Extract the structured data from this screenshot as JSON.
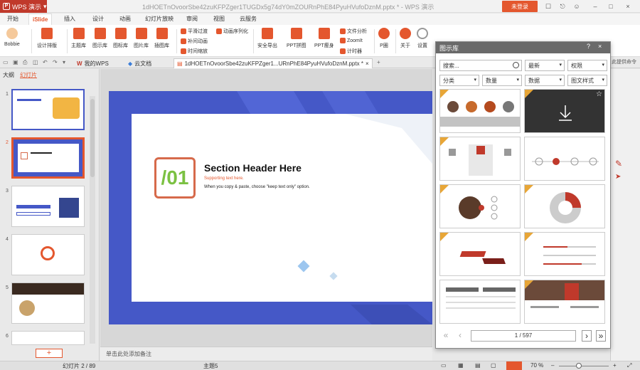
{
  "titlebar": {
    "app_name": "WPS 演示",
    "doc_title": "1dHOETnOvoorSbe42zuKFPZger1TUGDx5g74dY0mZOURnPhE84PyuHVufoDznM.pptx * - WPS 演示",
    "login": "未登录"
  },
  "menu": [
    "开始",
    "iSlide",
    "插入",
    "设计",
    "动画",
    "幻灯片放映",
    "审阅",
    "视图",
    "云服务"
  ],
  "ribbon": {
    "user": "Bobbie",
    "design_layout": "设计排版",
    "theme_lib": "主题库",
    "chart_lib": "图示库",
    "icon_lib": "图标库",
    "picture_lib": "图片库",
    "illustration_lib": "插图库",
    "smooth_transition": "平滑过渡",
    "animation_seq": "动画序列化",
    "supplement_animation": "补间动画",
    "time_scale": "时间缩放",
    "safe_export": "安全导出",
    "ppt_puzzle": "PPT拼图",
    "ppt_slim": "PPT瘦身",
    "file_analysis": "文件分析",
    "zoomit": "ZoomIt",
    "timer": "计时器",
    "p_circle": "P圈",
    "about": "关于",
    "settings": "设置"
  },
  "tabs": {
    "my_wps": "我的WPS",
    "cloud_doc": "云文档",
    "active_doc": "1dHOETnOvoorSbe42zuKFPZger1...URnPhE84PyuHVufoDznM.pptx *"
  },
  "leftpane": {
    "tab_outline": "大纲",
    "tab_slides": "幻灯片",
    "slide_numbers": [
      "1",
      "2",
      "3",
      "4",
      "5",
      "6"
    ]
  },
  "slide": {
    "number": "/01",
    "title": "Section Header Here",
    "subtitle": "Supporting text here.",
    "note": "When you copy & paste, choose \"keep text only\" option."
  },
  "notes_placeholder": "单击此处添加备注",
  "right_label": "此提供命令",
  "panel": {
    "title": "图示库",
    "help": "?",
    "close": "×",
    "search_placeholder": "搜索...",
    "sort": "最新",
    "rights": "权限",
    "category": "分类",
    "count": "数量",
    "data": "数据",
    "style": "图文样式",
    "page_indicator": "1 / 597"
  },
  "statusbar": {
    "slide_position": "幻灯片 2 / 89",
    "theme": "主题5",
    "zoom": "70 %"
  },
  "colors": {
    "accent": "#e4572e",
    "slide_blue": "#4558c7",
    "number_green": "#7bc142"
  }
}
